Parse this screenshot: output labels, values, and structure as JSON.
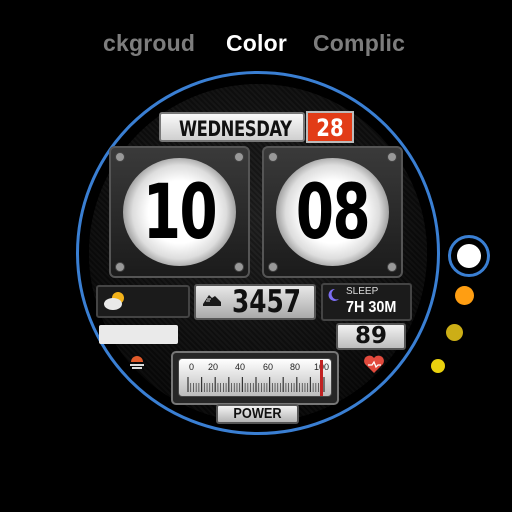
{
  "tabs": [
    {
      "label": "ckgroud",
      "active": false
    },
    {
      "label": "Color",
      "active": true
    },
    {
      "label": "Complic",
      "active": false
    }
  ],
  "watch": {
    "day": "WEDNESDAY",
    "date": "28",
    "hour": "10",
    "minute": "08",
    "steps": "3457",
    "sleep_label": "SLEEP",
    "sleep_value": "7H 30M",
    "heart_rate": "89",
    "gauge_ticks": [
      "0",
      "20",
      "40",
      "60",
      "80",
      "100"
    ],
    "gauge_level": 0.97,
    "gauge_label": "POWER"
  },
  "colors": {
    "selection_ring": "#3a7fd3",
    "date_accent": "#e23c17",
    "swatches": [
      "#ffffff",
      "#ff9e12",
      "#ccae16",
      "#e9d10e"
    ],
    "selected_swatch": "#ffffff"
  },
  "icons": {
    "weather": "partly-cloudy-icon",
    "steps": "shoe-icon",
    "sleep": "moon-icon",
    "heart": "heart-icon",
    "hazard": "sunset-icon"
  }
}
